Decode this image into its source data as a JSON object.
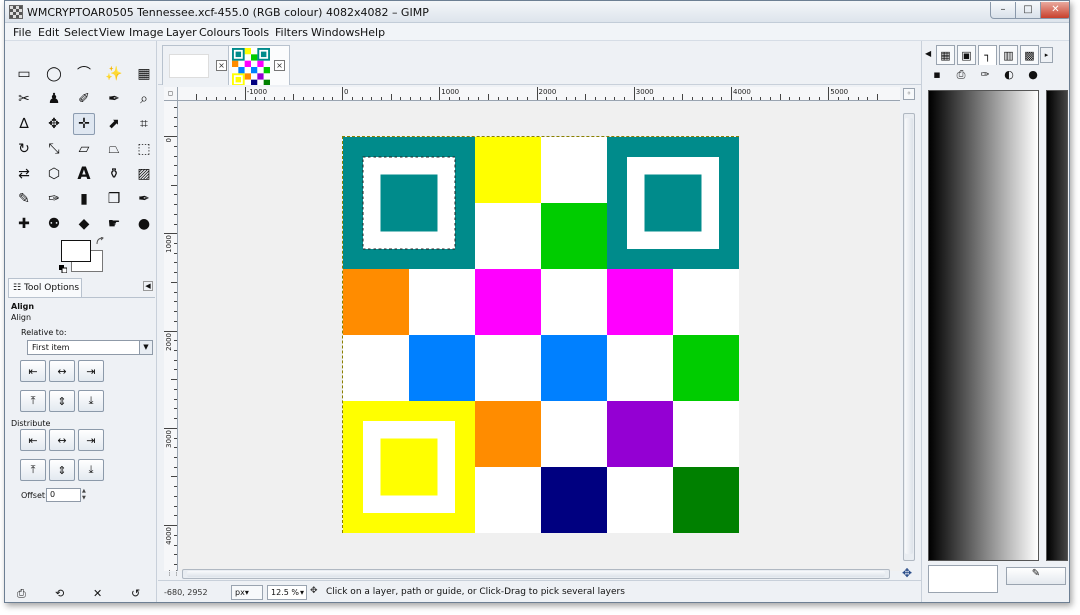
{
  "window": {
    "title": "WMCRYPTOAR0505 Tennessee.xcf-455.0 (RGB colour) 4082x4082 – GIMP",
    "minimize_glyph": "–",
    "maximize_glyph": "□",
    "close_glyph": "✕"
  },
  "menu": [
    "File",
    "Edit",
    "Select",
    "View",
    "Image",
    "Layer",
    "Colours",
    "Tools",
    "Filters",
    "Windows",
    "Help"
  ],
  "toolbox": {
    "tools": [
      {
        "name": "rect-select-icon",
        "glyph": "▭"
      },
      {
        "name": "ellipse-select-icon",
        "glyph": "◯"
      },
      {
        "name": "free-select-icon",
        "glyph": "⌒"
      },
      {
        "name": "fuzzy-select-icon",
        "glyph": "✨"
      },
      {
        "name": "select-by-color-icon",
        "glyph": "▦"
      },
      {
        "name": "scissors-select-icon",
        "glyph": "✂"
      },
      {
        "name": "foreground-select-icon",
        "glyph": "♟"
      },
      {
        "name": "paths-icon",
        "glyph": "✐"
      },
      {
        "name": "color-picker-icon",
        "glyph": "✒"
      },
      {
        "name": "zoom-icon",
        "glyph": "⌕"
      },
      {
        "name": "measure-icon",
        "glyph": "∆"
      },
      {
        "name": "move-icon",
        "glyph": "✥"
      },
      {
        "name": "align-icon",
        "glyph": "✛"
      },
      {
        "name": "transform-icon",
        "glyph": "⬈"
      },
      {
        "name": "crop-icon",
        "glyph": "⌗"
      },
      {
        "name": "rotate-icon",
        "glyph": "↻"
      },
      {
        "name": "scale-icon",
        "glyph": "⤡"
      },
      {
        "name": "shear-icon",
        "glyph": "▱"
      },
      {
        "name": "perspective-icon",
        "glyph": "⏢"
      },
      {
        "name": "unified-transform-icon",
        "glyph": "⬚"
      },
      {
        "name": "flip-icon",
        "glyph": "⇄"
      },
      {
        "name": "cage-transform-icon",
        "glyph": "⬡"
      },
      {
        "name": "text-icon",
        "glyph": "A"
      },
      {
        "name": "bucket-fill-icon",
        "glyph": "⚱"
      },
      {
        "name": "blend-icon",
        "glyph": "▨"
      },
      {
        "name": "pencil-icon",
        "glyph": "✎"
      },
      {
        "name": "paintbrush-icon",
        "glyph": "✑"
      },
      {
        "name": "eraser-icon",
        "glyph": "▮"
      },
      {
        "name": "airbrush-icon",
        "glyph": "❒"
      },
      {
        "name": "ink-icon",
        "glyph": "✒"
      },
      {
        "name": "heal-icon",
        "glyph": "✚"
      },
      {
        "name": "clone-icon",
        "glyph": "⚉"
      },
      {
        "name": "blur-icon",
        "glyph": "◆"
      },
      {
        "name": "smudge-icon",
        "glyph": "☛"
      },
      {
        "name": "dodge-burn-icon",
        "glyph": "●"
      }
    ],
    "tool_options_tab": "Tool Options",
    "tool_options_title": "Align",
    "tool_options_subtitle": "Align",
    "relative_to_label": "Relative to:",
    "relative_to_value": "First item",
    "distribute_label": "Distribute",
    "offset_label": "Offset:",
    "offset_value": "0",
    "align_buttons": [
      "⇤",
      "↔",
      "⇥",
      "⤒",
      "⇕",
      "⤓"
    ],
    "distribute_buttons": [
      "⇤",
      "↔",
      "⇥",
      "⤒",
      "⇕",
      "⤓"
    ],
    "bottom_icons": [
      "⎙",
      "⟲",
      "✕",
      "↺"
    ]
  },
  "image_tabs": {
    "close_glyph": "×"
  },
  "rulers": {
    "h_ticks": [
      "-1000",
      "0",
      "1000",
      "2000",
      "3000",
      "4000",
      "5000"
    ],
    "v_ticks": [
      "0",
      "1000",
      "2000",
      "3000",
      "4000"
    ]
  },
  "image": {
    "grid": [
      [
        "finder",
        "finder",
        "#ffff00",
        "#ffffff",
        "finder",
        "finder"
      ],
      [
        "finder",
        "finder",
        "#ffffff",
        "#00cc00",
        "finder",
        "finder"
      ],
      [
        "#ff8c00",
        "#ffffff",
        "#ff00ff",
        "#ffffff",
        "#ff00ff",
        "#ffffff"
      ],
      [
        "#ffffff",
        "#0080ff",
        "#ffffff",
        "#0080ff",
        "#ffffff",
        "#00cc00"
      ],
      [
        "finder",
        "finder",
        "#ff8c00",
        "#ffffff",
        "#9400d3",
        "#ffffff"
      ],
      [
        "finder",
        "finder",
        "#ffffff",
        "#000080",
        "#ffffff",
        "#008000"
      ]
    ],
    "finders": [
      {
        "pos": "top-left",
        "color": "#008b8b"
      },
      {
        "pos": "top-right",
        "color": "#008b8b"
      },
      {
        "pos": "bottom-left",
        "color": "#ffff00"
      }
    ]
  },
  "statusbar": {
    "coords": "-680, 2952",
    "unit": "px▾",
    "zoom": "12.5 %",
    "zoom_arrow": "▾",
    "message": "Click on a layer, path or guide, or Click-Drag to pick several layers"
  },
  "dock": {
    "tabs": [
      "▦",
      "▣",
      "┐",
      "▥",
      "▩"
    ],
    "sub_icons": [
      "▪",
      "⎙",
      "✑",
      "◐",
      "●"
    ],
    "collapse_glyph": "◀",
    "config_glyph": "▸",
    "action_glyph": "✎"
  },
  "colors": {
    "teal": "#008b8b",
    "selection_border": "#8a8000",
    "accent": "#2a4d8a"
  }
}
